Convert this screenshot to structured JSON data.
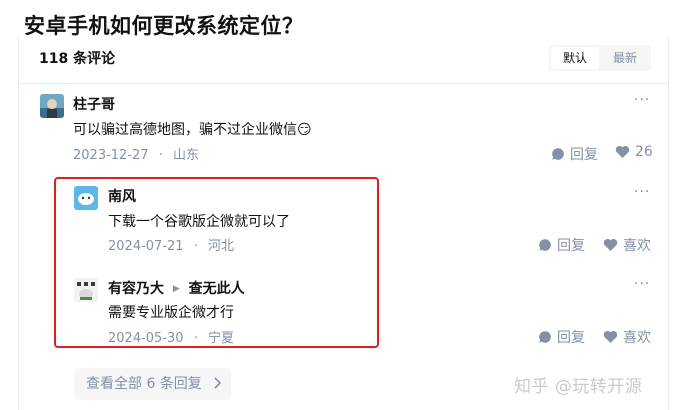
{
  "page": {
    "title": "安卓手机如何更改系统定位？"
  },
  "comments_header": {
    "count_label": "118 条评论",
    "sort_options": [
      "默认",
      "最新"
    ]
  },
  "comment": {
    "author": "柱子哥",
    "text": "可以骗过高德地图，骗不过企业微信",
    "emoji": "😏",
    "date": "2023-12-27",
    "location": "山东",
    "reply_label": "回复",
    "like_count": "26"
  },
  "replies": [
    {
      "author": "南风",
      "text": "下载一个谷歌版企微就可以了",
      "date": "2024-07-21",
      "location": "河北",
      "reply_label": "回复",
      "like_label": "喜欢"
    },
    {
      "author": "有容乃大",
      "reply_to": "查无此人",
      "text": "需要专业版企微才行",
      "date": "2024-05-30",
      "location": "宁夏",
      "reply_label": "回复",
      "like_label": "喜欢"
    }
  ],
  "view_all": {
    "label": "查看全部 6 条回复",
    "icon": "chevron-right-icon"
  },
  "watermark": "知乎 @玩转开源",
  "separator": "·",
  "colors": {
    "highlight": "#e02020",
    "muted": "#8590a6",
    "text": "#121212"
  }
}
